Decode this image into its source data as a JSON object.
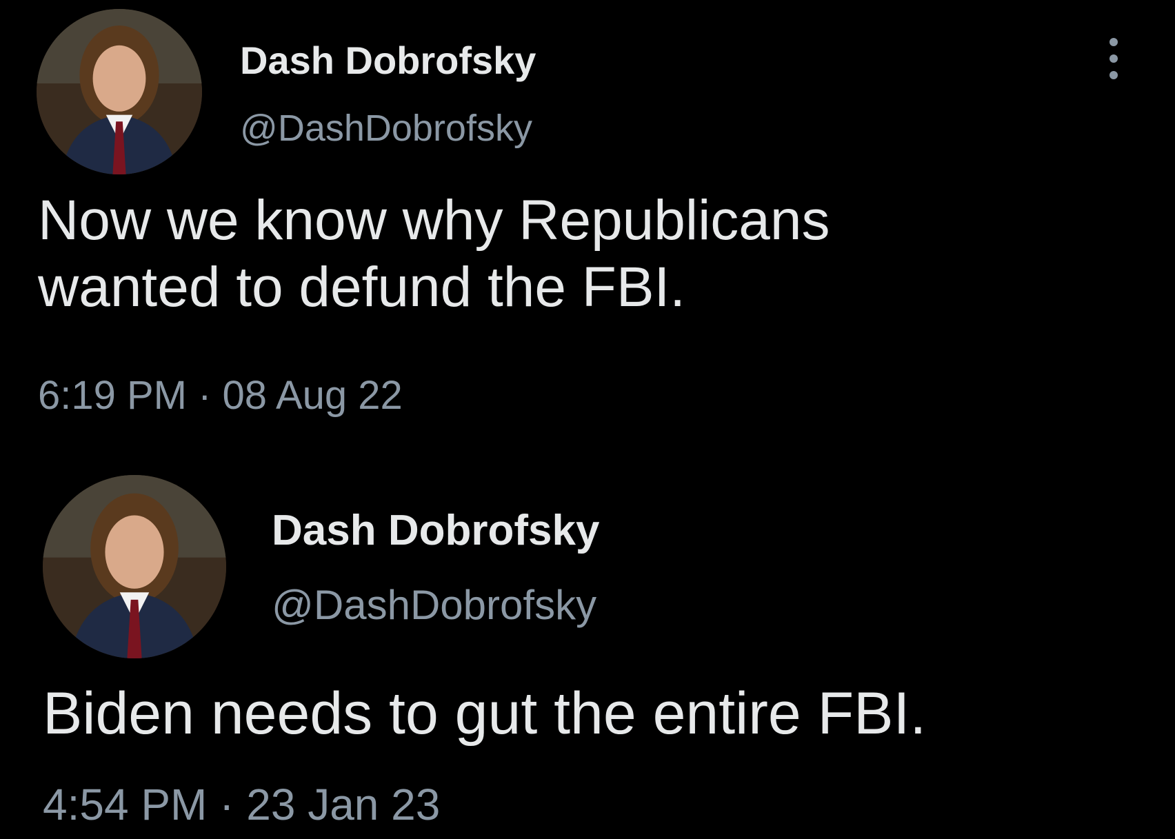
{
  "tweets": [
    {
      "author": {
        "display_name": "Dash Dobrofsky",
        "handle": "@DashDobrofsky",
        "avatar_icon": "profile-photo"
      },
      "text_lines": [
        "Now we know why Republicans",
        "wanted to defund the FBI."
      ],
      "timestamp": "6:19 PM · 08 Aug 22",
      "more_icon": "more-vertical-icon"
    },
    {
      "author": {
        "display_name": "Dash Dobrofsky",
        "handle": "@DashDobrofsky",
        "avatar_icon": "profile-photo"
      },
      "text_lines": [
        "Biden needs to gut the entire FBI."
      ],
      "timestamp": "4:54 PM · 23 Jan 23"
    }
  ],
  "colors": {
    "background": "#000000",
    "primary_text": "#e7e9ea",
    "secondary_text": "#8b98a5"
  }
}
